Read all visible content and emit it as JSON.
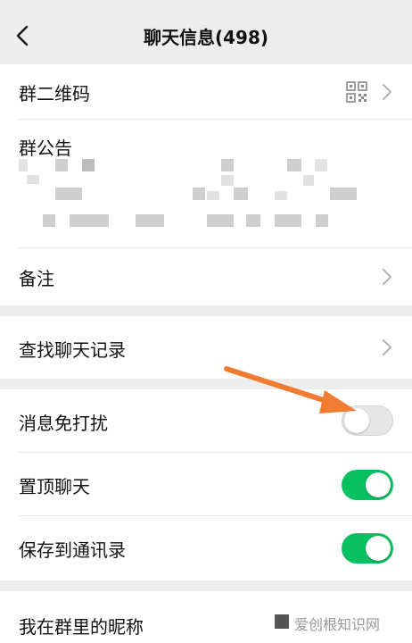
{
  "header": {
    "title": "聊天信息(498)"
  },
  "rows": {
    "qr_code": "群二维码",
    "announcement": "群公告",
    "remark": "备注",
    "search_history": "查找聊天记录",
    "mute": "消息免打扰",
    "pin": "置顶聊天",
    "save_contacts": "保存到通讯录",
    "nickname": "我在群里的昵称"
  },
  "toggles": {
    "mute_on": false,
    "pin_on": true,
    "save_contacts_on": true
  },
  "colors": {
    "toggle_on": "#07c160",
    "annotation_arrow": "#f07c32"
  },
  "watermark": "爱创根知识网",
  "icons": {
    "back": "chevron-left-icon",
    "qr": "qr-code-icon",
    "more": "chevron-right-icon"
  }
}
